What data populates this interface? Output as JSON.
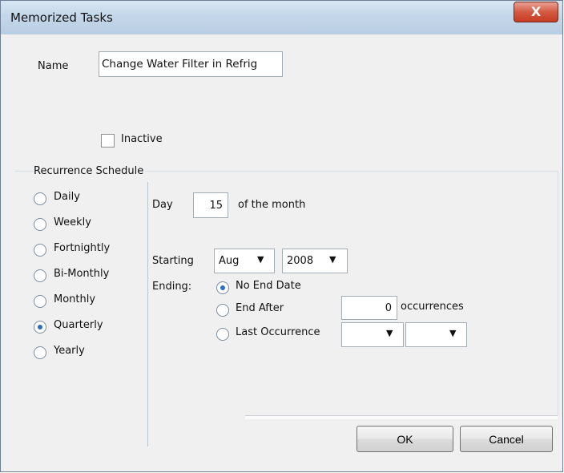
{
  "window": {
    "title": "Memorized Tasks",
    "close_glyph": "X"
  },
  "form": {
    "name_label": "Name",
    "name_value": "Change Water Filter in Refrig",
    "inactive_label": "Inactive",
    "inactive_checked": false
  },
  "recurrence": {
    "group_label": "Recurrence Schedule",
    "options": [
      "Daily",
      "Weekly",
      "Fortnightly",
      "Bi-Monthly",
      "Monthly",
      "Quarterly",
      "Yearly"
    ],
    "selected": "Quarterly",
    "day_label": "Day",
    "day_value": "15",
    "of_month_label": "of the month",
    "starting_label": "Starting",
    "start_month": "Aug",
    "start_year": "2008",
    "ending_label": "Ending:",
    "ending_options": {
      "no_end": "No End Date",
      "end_after": "End After",
      "last_occurrence": "Last Occurrence"
    },
    "ending_selected": "No End Date",
    "occurrences_value": "0",
    "occurrences_label": "occurrences",
    "last_month": "",
    "last_year": ""
  },
  "buttons": {
    "ok": "OK",
    "cancel": "Cancel"
  }
}
